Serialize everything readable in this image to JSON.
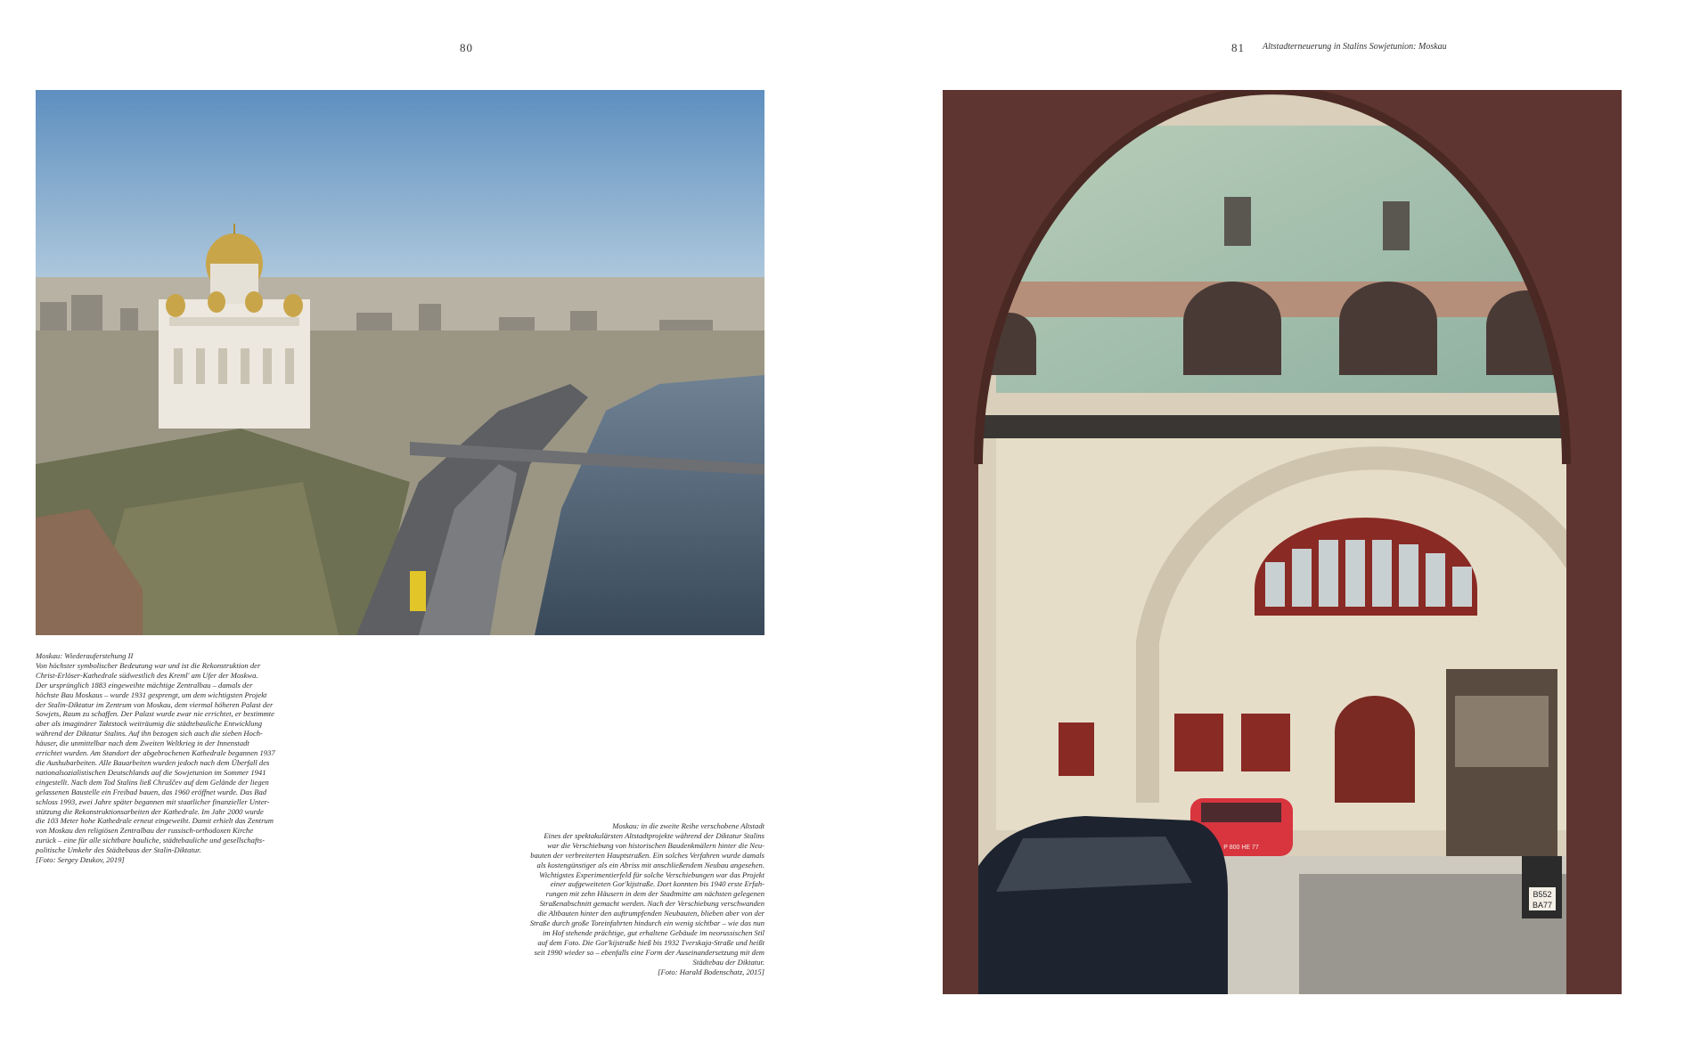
{
  "left_page": {
    "page_number": "80",
    "photo_alt": "Aerial view of the Cathedral of Christ the Saviour and the Moskva river",
    "caption": {
      "title": "Moskau: Wiederauferstehung II",
      "body": "Von höchster symbolischer Bedeutung war und ist die Rekonstruktion der\nChrist-Erlöser-Kathedrale südwestlich des Kreml' am Ufer der Moskwa.\nDer ursprünglich 1883 eingeweihte mächtige Zentralbau – damals der\nhöchste Bau Moskaus – wurde 1931 gesprengt, um dem wichtigsten Projekt\nder Stalin-Diktatur im Zentrum von Moskau, dem viermal höheren Palast der\nSowjets, Raum zu schaffen. Der Palast wurde zwar nie errichtet, er bestimmte\naber als imaginärer Taktstock weiträumig die städtebauliche Entwicklung\nwährend der Diktatur Stalins. Auf ihn bezogen sich auch die sieben Hoch-\nhäuser, die unmittelbar nach dem Zweiten Weltkrieg in der Innenstadt\nerrichtet wurden. Am Standort der abgebrochenen Kathedrale begannen 1937\ndie Aushubarbeiten. Alle Bauarbeiten wurden jedoch nach dem Überfall des\nnationalsozialistischen Deutschlands auf die Sowjetunion im Sommer 1941\neingestellt. Nach dem Tod Stalins ließ Chruščev auf dem Gelände der liegen\ngelassenen Baustelle ein Freibad bauen, das 1960 eröffnet wurde. Das Bad\nschloss 1993, zwei Jahre später begannen mit staatlicher finanzieller Unter-\nstützung die Rekonstruktionsarbeiten der Kathedrale. Im Jahr 2000 wurde\ndie 103 Meter hohe Kathedrale erneut eingeweiht. Damit erhielt das Zentrum\nvon Moskau den religiösen Zentralbau der russisch-orthodoxen Kirche\nzurück – eine für alle sichtbare bauliche, städtebauliche und gesellschafts-\npolitische Umkehr des Städtebaus der Stalin-Diktatur.",
      "credit": "[Foto: Sergey Dzukov, 2019]"
    },
    "caption2": {
      "title": "Moskau: in die zweite Reihe verschobene Altstadt",
      "body": "Eines der spektakulärsten Altstadtprojekte während der Diktatur Stalins\nwar die Verschiebung von historischen Baudenkmälern hinter die Neu-\nbauten der verbreiterten Hauptstraßen. Ein solches Verfahren wurde damals\nals kostengünstiger als ein Abriss mit anschließendem Neubau angesehen.\nWichtigstes Experimentierfeld für solche Verschiebungen war das Projekt\neiner aufgeweiteten Gor'kijstraße. Dort konnten bis 1940 erste Erfah-\nrungen mit zehn Häusern in dem der Stadtmitte am nächsten gelegenen\nStraßenabschnitt gemacht werden. Nach der Verschiebung verschwanden\ndie Altbauten hinter den auftrumpfenden Neubauten, blieben aber von der\nStraße durch große Toreinfahrten hindurch ein wenig sichtbar – wie das nun\nim Hof stehende prächtige, gut erhaltene Gebäude im neorussischen Stil\nauf dem Foto. Die Gor'kijstraße hieß bis 1932 Tverskaja-Straße und heißt\nseit 1990 wieder so – ebenfalls eine Form der Auseinandersetzung mit dem\nStädtebau der Diktatur.",
      "credit": "[Foto: Harald Bodenschatz, 2015]"
    }
  },
  "right_page": {
    "page_number": "81",
    "running_head": "Altstadterneuerung in Stalins Sowjetunion: Moskau",
    "photo_alt": "Courtyard view through an archway of a tiled neo-Russian building",
    "plate_top": "B552",
    "plate_bottom": "BA77",
    "car_plate": "P 800 HE 77"
  },
  "colors": {
    "sky": "#8fb3d4",
    "river": "#4a5a6a",
    "arch_brick": "#6b3a33",
    "tile_green": "#a9c4b0",
    "stucco": "#e8dfcd",
    "window_red": "#8a2a24",
    "car_red": "#d8353f"
  }
}
